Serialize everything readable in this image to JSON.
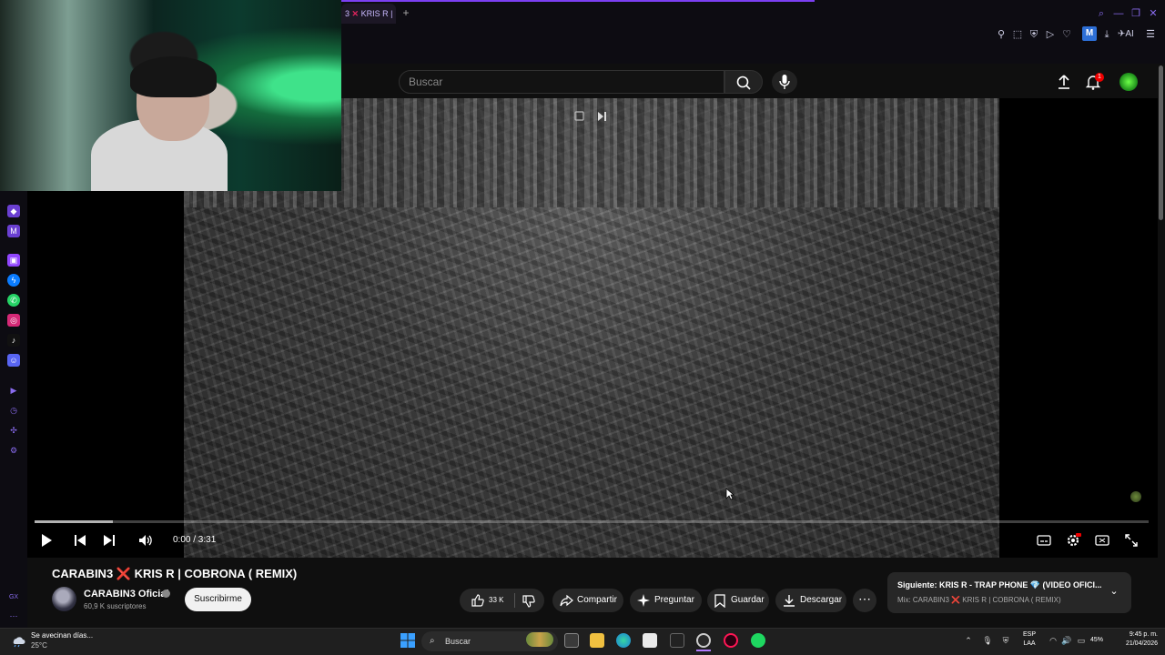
{
  "browser": {
    "tab_title": "3 ❌ KRIS R |",
    "tab_title_pre": "3",
    "tab_title_post": "KRIS R |",
    "new_tab": "+",
    "ai_label": "AI",
    "ext_m": "M",
    "accent": "#7b3ff2"
  },
  "youtube": {
    "search_placeholder": "Buscar",
    "notifications": "1",
    "video": {
      "time": "0:00 / 3:31",
      "progress": 0.07,
      "title_pre": "CARABIN3",
      "title_post": "KRIS R | COBRONA ( REMIX)"
    },
    "channel": {
      "name": "CARABIN3 Oficial",
      "subscribers": "60,9 K suscriptores",
      "subscribe_label": "Suscribirme"
    },
    "actions": {
      "likes": "33 K",
      "share": "Compartir",
      "ask": "Preguntar",
      "save": "Guardar",
      "download": "Descargar",
      "more": "⋯"
    },
    "next": {
      "line1": "Siguiente: KRIS R - TRAP PHONE 💎 (VIDEO OFICI...",
      "line2": "Mix: CARABIN3 ❌ KRIS R | COBRONA ( REMIX)"
    }
  },
  "taskbar": {
    "weather_line1": "Se avecinan días...",
    "weather_line2": "25°C",
    "search": "Buscar",
    "lang_line1": "ESP",
    "lang_line2": "LAA",
    "battery": "45%",
    "time": "9:45 p. m.",
    "date": "21/04/2026"
  },
  "sidebar": {
    "bottom_label": "GX"
  }
}
